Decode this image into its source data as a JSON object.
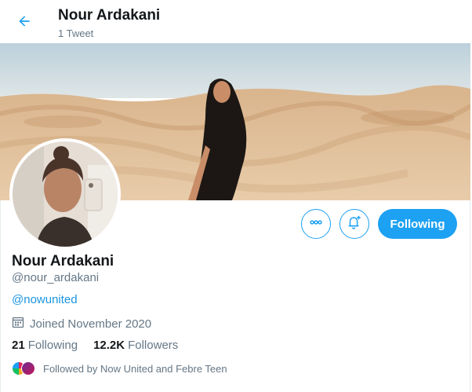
{
  "header": {
    "back_icon": "arrow-left-icon",
    "name": "Nour Ardakani",
    "tweet_count": "1 Tweet"
  },
  "banner": {
    "description_icon": "banner-photo"
  },
  "actions": {
    "more_icon": "more-horizontal-icon",
    "notify_icon": "bell-plus-icon",
    "follow_label": "Following"
  },
  "profile": {
    "name": "Nour Ardakani",
    "handle": "@nour_ardakani",
    "bio_link": "@nowunited",
    "joined_icon": "calendar-icon",
    "joined": "Joined November 2020",
    "following_count": "21",
    "following_label": "Following",
    "followers_count": "12.2K",
    "followers_label": "Followers",
    "followed_by": "Followed by Now United and Febre Teen"
  },
  "colors": {
    "accent": "#1da1f2",
    "link": "#1b95e0",
    "secondary_text": "#657786",
    "primary_text": "#14171a"
  }
}
